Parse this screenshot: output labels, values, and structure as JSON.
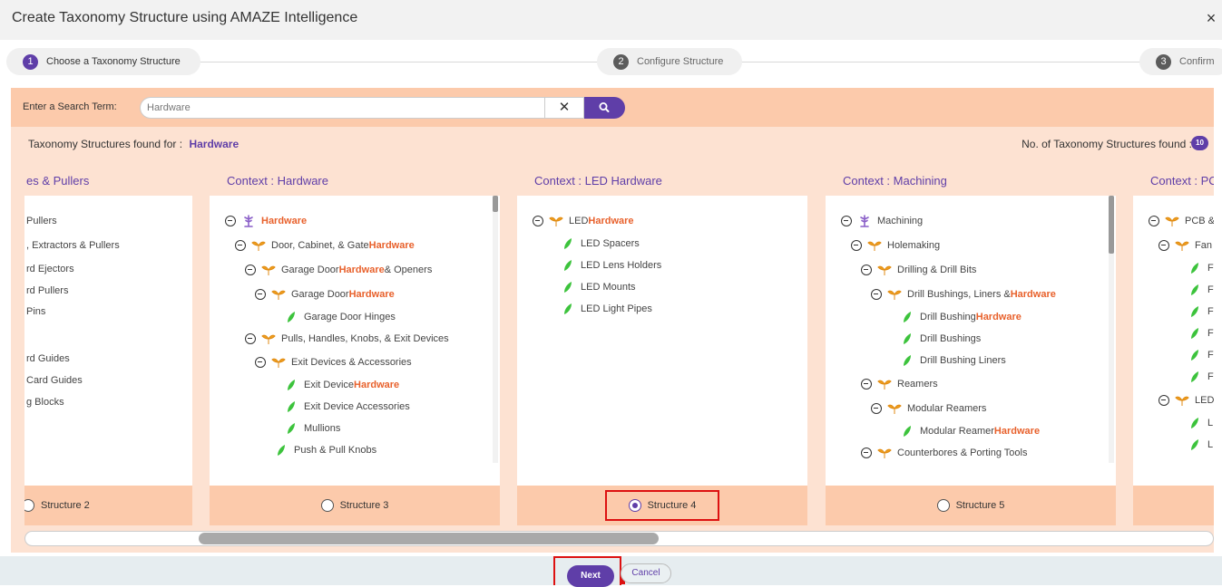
{
  "dialog": {
    "title": "Create Taxonomy Structure using AMAZE Intelligence",
    "close_label": "×"
  },
  "steps": [
    {
      "num": "1",
      "label": "Choose a Taxonomy Structure"
    },
    {
      "num": "2",
      "label": "Configure Structure"
    },
    {
      "num": "3",
      "label": "Confirm"
    }
  ],
  "search": {
    "label": "Enter a Search Term:",
    "value": "Hardware",
    "clear_label": "✕"
  },
  "results": {
    "found_for_label": "Taxonomy Structures found for :",
    "term": "Hardware",
    "count_label": "No. of Taxonomy Structures found :",
    "count": "10"
  },
  "cards": [
    {
      "title": "es & Pullers",
      "items": [
        {
          "t": "Pullers"
        },
        {
          "t": ", Extractors & Pullers"
        },
        {
          "t": "rd Ejectors"
        },
        {
          "t": "rd Pullers"
        },
        {
          "t": "Pins"
        },
        {
          "t": ""
        },
        {
          "t": "rd Guides"
        },
        {
          "t": "Card Guides"
        },
        {
          "t": "g Blocks"
        }
      ],
      "radio_label": "Structure 2"
    },
    {
      "title": "Context : Hardware",
      "items": [
        {
          "pre": "",
          "hl": "Hardware",
          "post": ""
        },
        {
          "pre": "Door, Cabinet, & Gate ",
          "hl": "Hardware",
          "post": ""
        },
        {
          "pre": "Garage Door ",
          "hl": "Hardware",
          "post": " & Openers"
        },
        {
          "pre": "Garage Door ",
          "hl": "Hardware",
          "post": ""
        },
        {
          "pre": "Garage Door Hinges",
          "hl": "",
          "post": ""
        },
        {
          "pre": "Pulls, Handles, Knobs, & Exit Devices",
          "hl": "",
          "post": ""
        },
        {
          "pre": "Exit Devices & Accessories",
          "hl": "",
          "post": ""
        },
        {
          "pre": "Exit Device ",
          "hl": "Hardware",
          "post": ""
        },
        {
          "pre": "Exit Device Accessories",
          "hl": "",
          "post": ""
        },
        {
          "pre": "Mullions",
          "hl": "",
          "post": ""
        },
        {
          "pre": "Push & Pull Knobs",
          "hl": "",
          "post": ""
        }
      ],
      "radio_label": "Structure 3"
    },
    {
      "title": "Context : LED Hardware",
      "items": [
        {
          "pre": "LED ",
          "hl": "Hardware",
          "post": ""
        },
        {
          "pre": "LED Spacers",
          "hl": "",
          "post": ""
        },
        {
          "pre": "LED Lens Holders",
          "hl": "",
          "post": ""
        },
        {
          "pre": "LED Mounts",
          "hl": "",
          "post": ""
        },
        {
          "pre": "LED Light Pipes",
          "hl": "",
          "post": ""
        }
      ],
      "radio_label": "Structure 4"
    },
    {
      "title": "Context : Machining",
      "items": [
        {
          "pre": "Machining",
          "hl": "",
          "post": ""
        },
        {
          "pre": "Holemaking",
          "hl": "",
          "post": ""
        },
        {
          "pre": "Drilling & Drill Bits",
          "hl": "",
          "post": ""
        },
        {
          "pre": "Drill Bushings, Liners & ",
          "hl": "Hardware",
          "post": ""
        },
        {
          "pre": "Drill Bushing ",
          "hl": "Hardware",
          "post": ""
        },
        {
          "pre": "Drill Bushings",
          "hl": "",
          "post": ""
        },
        {
          "pre": "Drill Bushing Liners",
          "hl": "",
          "post": ""
        },
        {
          "pre": "Reamers",
          "hl": "",
          "post": ""
        },
        {
          "pre": "Modular Reamers",
          "hl": "",
          "post": ""
        },
        {
          "pre": "Modular Reamer ",
          "hl": "Hardware",
          "post": ""
        },
        {
          "pre": "Counterbores & Porting Tools",
          "hl": "",
          "post": ""
        }
      ],
      "radio_label": "Structure 5"
    },
    {
      "title": "Context : PC",
      "items": [
        {
          "t": "PCB &"
        },
        {
          "t": "Fan"
        },
        {
          "t": "Fa"
        },
        {
          "t": "Fa"
        },
        {
          "t": "Fa"
        },
        {
          "t": "Fa"
        },
        {
          "t": "Fa"
        },
        {
          "t": "Fa"
        },
        {
          "t": "LED"
        },
        {
          "t": "LE"
        },
        {
          "t": "LE"
        }
      ]
    }
  ],
  "footer": {
    "next_label": "Next",
    "cancel_label": "Cancel"
  },
  "colors": {
    "accent": "#5f3ea8",
    "highlight": "#e8612c",
    "panel": "#fde2d2",
    "panel_dark": "#fccaab"
  }
}
